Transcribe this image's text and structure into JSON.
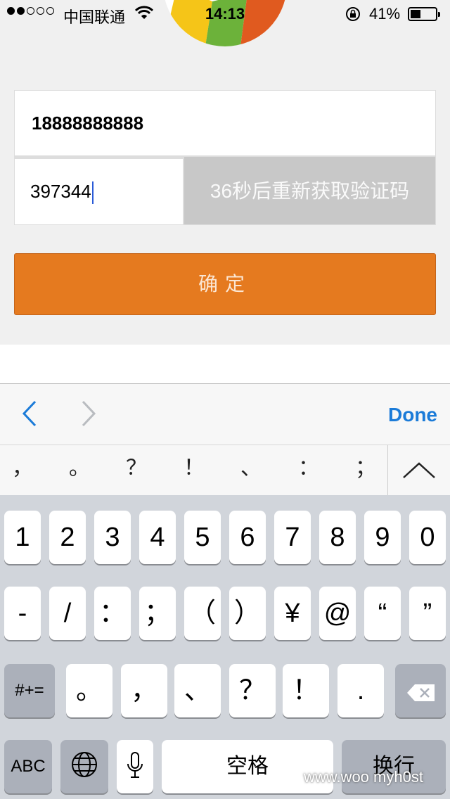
{
  "status_bar": {
    "carrier": "中国联通",
    "time": "14:13",
    "battery_percent": "41%",
    "battery_level": 0.41,
    "signal_bars": 2
  },
  "form": {
    "phone_value": "18888888888",
    "code_value": "397344",
    "resend_label": "36秒后重新获取验证码",
    "confirm_label": "确定",
    "accent_color": "#e57a1f"
  },
  "keyboard_toolbar": {
    "done_label": "Done",
    "link_color": "#1b7bd8"
  },
  "candidates": [
    "，",
    "。",
    "？",
    "！",
    "、",
    "：",
    "；"
  ],
  "keyboard": {
    "row1": [
      "1",
      "2",
      "3",
      "4",
      "5",
      "6",
      "7",
      "8",
      "9",
      "0"
    ],
    "row2": [
      "-",
      "/",
      "：",
      "；",
      "（",
      "）",
      "¥",
      "@",
      "“",
      "”"
    ],
    "row3": [
      "#+=",
      "。",
      "，",
      "、",
      "？",
      "！",
      "."
    ],
    "abc_label": "ABC",
    "space_label": "空格",
    "return_label": "换行"
  },
  "watermark": "www.woo  myh0st"
}
